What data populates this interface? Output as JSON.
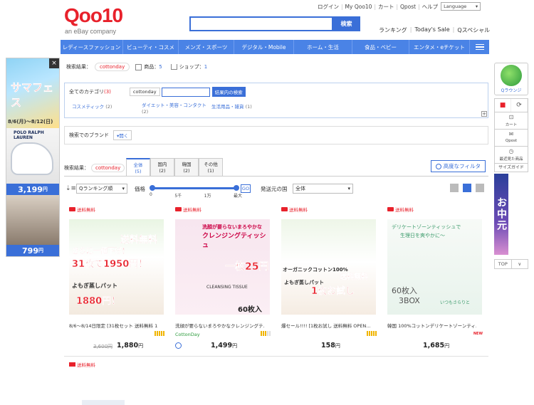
{
  "header": {
    "logo": "Qoo10",
    "logo_sub": "an eBay company",
    "top_links": [
      "ログイン",
      "My Qoo10",
      "カート",
      "Qpost",
      "ヘルプ"
    ],
    "language": "Language",
    "search_button": "検索",
    "search_value": "",
    "sub_links": [
      "ランキング",
      "Today's Sale",
      "Qスペシャル"
    ]
  },
  "nav": {
    "items": [
      "レディースファッション",
      "ビューティ・コスメ",
      "メンズ・スポーツ",
      "デジタル・Mobile",
      "ホーム・生活",
      "食品・ベビー",
      "エンタメ・eチケット"
    ]
  },
  "ads": {
    "banner_text": "サマフェス",
    "banner_date": "8/6(月)〜8/12(日)",
    "brand": "POLO RALPH LAUREN",
    "price1": "3,199",
    "price2": "799",
    "yen": "円",
    "close": "×"
  },
  "result": {
    "label": "検索結果：",
    "keyword": "cottonday",
    "products_label": "商品：",
    "products_count": "5",
    "shops_label": "ショップ：",
    "shops_count": "1"
  },
  "filter": {
    "all_categories": "全てのカテゴリ",
    "all_count": "(3)",
    "keyword": "cottonday",
    "refine_button": "結果内の検索",
    "categories": [
      {
        "name": "コスメティック",
        "count": "(2)"
      },
      {
        "name": "ダイエット・美容・コンタクト",
        "count": "(2)"
      },
      {
        "name": "生活用品・雑貨",
        "count": "(1)"
      }
    ],
    "plus": "+"
  },
  "brand_filter": {
    "label": "検索でのブランド",
    "button": "開く"
  },
  "tabs": {
    "label": "検索結果：",
    "keyword": "cottonday",
    "items": [
      {
        "name": "全体",
        "count": "(5)"
      },
      {
        "name": "国内",
        "count": "(2)"
      },
      {
        "name": "韓国",
        "count": "(2)"
      },
      {
        "name": "その他",
        "count": "(1)"
      }
    ],
    "advanced_filter": "高度なフィルタ"
  },
  "sort": {
    "sort_value": "Qランキング順",
    "price_label": "価格",
    "ticks": [
      "0",
      "5千",
      "1万",
      "最大"
    ],
    "go": "GO",
    "ship_label": "発送元の国",
    "ship_value": "全体"
  },
  "products": [
    {
      "ship_tag": "送料無料",
      "img_text1": "送料無料",
      "img_text2": "さらに一値下げ！",
      "img_text3": "31枚で1950円！",
      "img_text4": "1880円！",
      "img_text5": "よもぎ蒸しパット",
      "name": "8/6〜8/14日限定 [31枚セット 送料無料 1...",
      "old_price": "3,600円",
      "price": "1,880",
      "seller": ""
    },
    {
      "ship_tag": "送料無料",
      "img_text1": "洗顔が要らないまろやかな",
      "img_text2": "クレンジングティッシュ",
      "img_text3": "一枚25円",
      "img_text4": "60枚入",
      "img_text5": "CLEANSING TISSUE",
      "name": "洗顔が要らないまろやかなクレンジングテ...",
      "old_price": "",
      "price": "1,499",
      "seller": "CottonDay"
    },
    {
      "ship_tag": "送料無料",
      "img_text1": "オーガニックコットン100%",
      "img_text2": "送料無料",
      "img_text3": "1枚お試し",
      "img_text4": "よもぎ蒸しパット",
      "img_text5": "",
      "name": "爆セール!!!! [1枚お試し 送料無料 OPEN...",
      "old_price": "",
      "price": "158",
      "seller": ""
    },
    {
      "ship_tag": "送料無料",
      "img_text1": "デリケートゾーンティッシュで",
      "img_text2": "生理日を爽やかに〜",
      "img_text3": "60枚入",
      "img_text4": "3BOX",
      "img_text5": "いつもさらりと",
      "name": "韓国 100%コットンデリケートゾーンティ...",
      "old_price": "",
      "price": "1,685",
      "seller": "",
      "badge": "NEW"
    }
  ],
  "yen": "円",
  "next_row_ship_tag": "送料無料",
  "right_sidebar": {
    "lounge": "Qラウンジ",
    "cart": "カート",
    "qpost": "Qpost",
    "recent": "最近見た商品",
    "size": "サイズガイド",
    "ad_text": "お中元",
    "top": "TOP",
    "down": "∨"
  },
  "colors": {
    "brand_red": "#e8212b",
    "brand_blue": "#3a6fd8",
    "nav_blue": "#4a83e6"
  }
}
